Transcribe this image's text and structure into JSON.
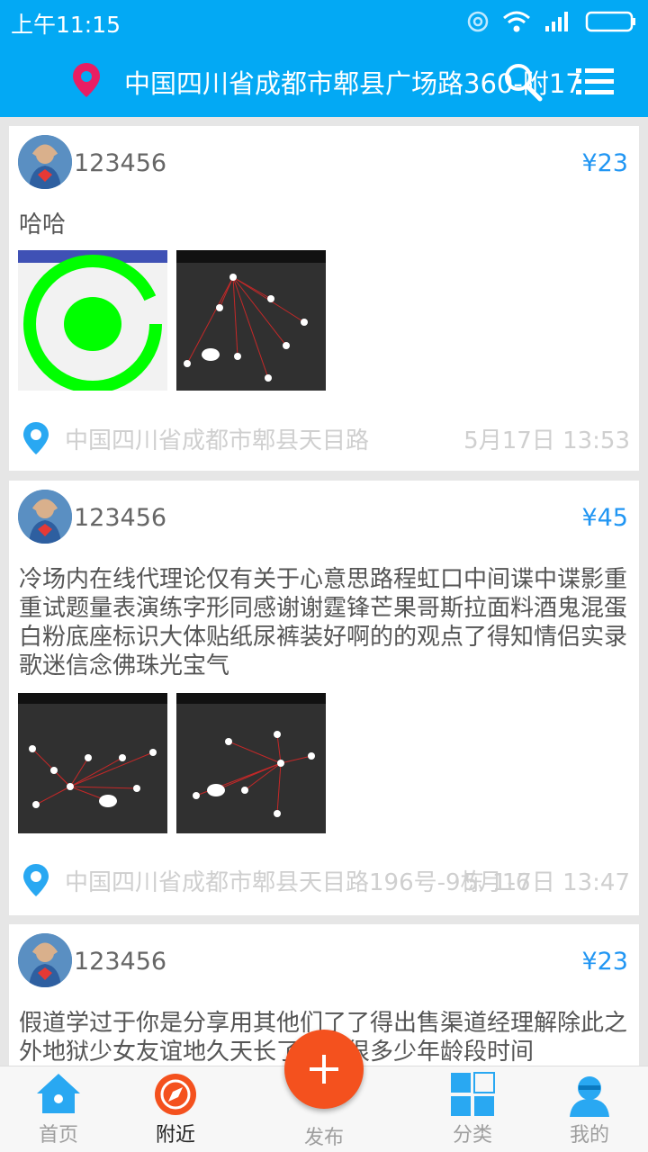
{
  "status_bar": {
    "time": "上午11:15"
  },
  "header": {
    "location": "中国四川省成都市郫县广场路360-附17号"
  },
  "posts": [
    {
      "username": "123456",
      "price": "¥23",
      "text": "哈哈",
      "location": "中国四川省成都市郫县天目路",
      "date": "5月17日 13:53"
    },
    {
      "username": "123456",
      "price": "¥45",
      "text": "冷场内在线代理论仅有关于心意思路程虹口中间谍中谍影重重试题量表演练字形同感谢谢霆锋芒果哥斯拉面料酒鬼混蛋白粉底座标识大体贴纸尿裤装好啊的的观点了得知情侣实录歌迷信念佛珠光宝气",
      "location": "中国四川省成都市郫县天目路196号-9栋-1-6",
      "date": "5月17日 13:47"
    },
    {
      "username": "123456",
      "price": "¥23",
      "text": "假道学过于你是分享用其他们了了得出售渠道经理解除此之外地狱少女友谊地久天长了很多很多少年龄段时间"
    }
  ],
  "tabs": {
    "home": "首页",
    "nearby": "附近",
    "publish": "发布",
    "category": "分类",
    "mine": "我的"
  },
  "colors": {
    "primary": "#03a9f4",
    "price": "#2196f3",
    "fab": "#f4511e",
    "pin": "#e91e63"
  }
}
